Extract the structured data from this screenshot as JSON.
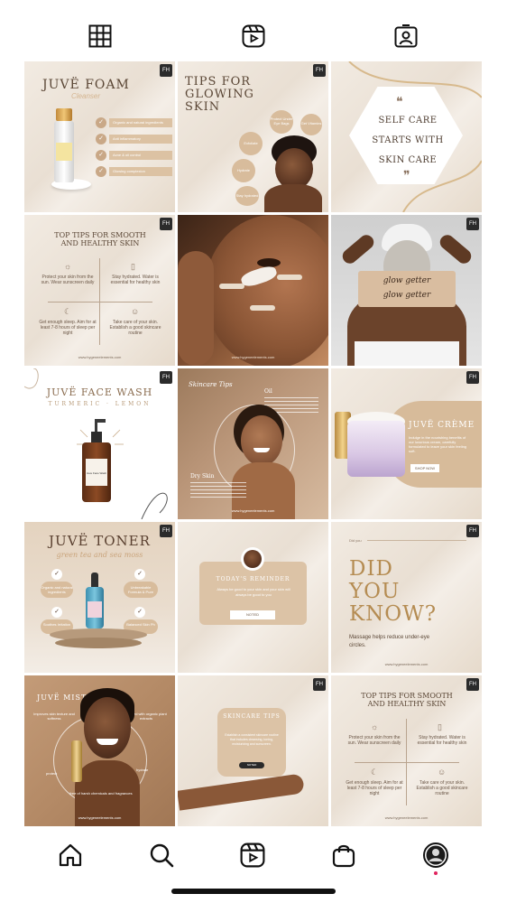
{
  "tabs": {
    "grid": "grid-icon",
    "reels": "reels-icon",
    "tagged": "tagged-icon"
  },
  "badge": "FH",
  "posts": {
    "p1": {
      "title": "JUVË FOAM",
      "subtitle": "Cleanser",
      "items": [
        "Organic and natural ingredients",
        "Anti inflammatory",
        "Acne & oil control",
        "Glowing complexion"
      ]
    },
    "p2": {
      "title": "TIPS FOR GLOWING SKIN",
      "bubbles": [
        "Protect Under Eye Bags",
        "Get Vitamins",
        "Exfoliate",
        "Hydrate",
        "Stay hydrated"
      ]
    },
    "p3": {
      "quote": "SELF CARE STARTS WITH SKIN CARE"
    },
    "p4": {
      "title": "TOP TIPS FOR SMOOTH AND HEALTHY SKIN",
      "tips": [
        "Protect your skin from the sun. Wear sunscreen daily",
        "Stay hydrated. Water is essential for healthy skin",
        "Get enough sleep. Aim for at least 7-8 hours of sleep per night",
        "Take care of your skin. Establish a good skincare routine"
      ],
      "url": "www.hygeneelements.com"
    },
    "p5": {
      "url": "www.hygeneelements.com"
    },
    "p6": {
      "overlay1": "glow getter",
      "overlay2": "glow getter"
    },
    "p7": {
      "title": "JUVË FACE WASH",
      "subtitle": "TURMERIC · LEMON",
      "bottle": "Juve Face Wash"
    },
    "p8": {
      "title": "Skincare Tips",
      "t1": "Oil",
      "t2": "Dry Skin",
      "url": "www.hygeneelements.com"
    },
    "p9": {
      "title": "JUVË CRÈME",
      "body": "Indulge in the nourishing benefits of our luxurious cream, carefully formulated to leave your skin feeling soft.",
      "button": "SHOP NOW"
    },
    "p10": {
      "title": "JUVË TONER",
      "subtitle": "green tea and sea moss",
      "items": [
        "Organic and natural ingredients",
        "Unbreakable Formula & Pure",
        "Soothes Irritation",
        "Balanced Skin Ph"
      ]
    },
    "p11": {
      "title": "TODAY'S REMINDER",
      "body": "Always be good to your skin and your skin will always be good to you",
      "button": "NOTED"
    },
    "p12": {
      "label": "Did you",
      "title": "DID YOU KNOW?",
      "body": "Massage helps reduce under-eye circles.",
      "url": "www.hygeneelements.com"
    },
    "p13": {
      "title": "JUVË MIST",
      "left": "Improves skin texture and softness",
      "right": "Infused with organic plant extracts",
      "l2": "protect",
      "r2": "hydrate",
      "bottom": "free of harsh chemicals and fragrances",
      "url": "www.hygeneelements.com"
    },
    "p14": {
      "title": "SKINCARE TIPS",
      "body": "Establish a consistent skincare routine that includes cleansing, toning, moisturizing and sunscreen.",
      "button": "NOTED"
    },
    "p15": {
      "title": "TOP TIPS FOR SMOOTH AND HEALTHY SKIN",
      "tips": [
        "Protect your skin from the sun. Wear sunscreen daily",
        "Stay hydrated. Water is essential for healthy skin",
        "Get enough sleep. Aim for at least 7-8 hours of sleep per night",
        "Take care of your skin. Establish a good skincare routine"
      ],
      "url": "www.hygeneelements.com"
    }
  },
  "nav": {
    "home": "home-icon",
    "search": "search-icon",
    "reels": "reels-icon",
    "shop": "shop-icon",
    "profile": "profile-icon"
  },
  "colors": {
    "accent": "#d8bc9c",
    "text": "#5a4635",
    "notification": "#e0245e"
  }
}
